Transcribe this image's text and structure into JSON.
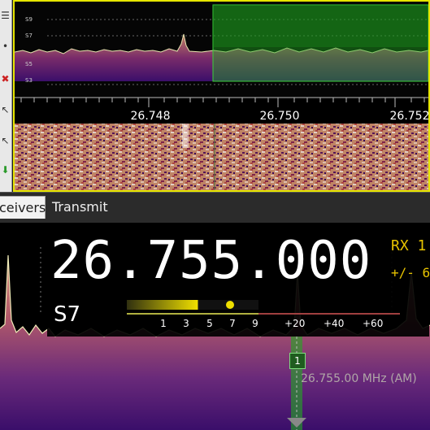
{
  "toolbar": {
    "buttons": [
      {
        "glyph": "☰",
        "icon": "menu-icon"
      },
      {
        "glyph": "•",
        "icon": "dot-icon"
      },
      {
        "glyph": "✖",
        "icon": "close-red-icon"
      },
      {
        "glyph": "↖",
        "icon": "pointer-icon"
      },
      {
        "glyph": "↖",
        "icon": "select-icon"
      },
      {
        "glyph": "⬇",
        "icon": "down-arrow-icon"
      }
    ]
  },
  "spectrum_top": {
    "db_labels": [
      "S9",
      "S7",
      "S5",
      "S3"
    ],
    "freq_labels": [
      "26.748",
      "26.750",
      "26.752"
    ],
    "passband_color": "#1a8f1a",
    "border_color": "#e6e600"
  },
  "tabs": [
    {
      "label": "ceivers",
      "active": true
    },
    {
      "label": "Transmit",
      "active": false
    }
  ],
  "receiver": {
    "frequency": "26.755.000",
    "rx_label": "RX 1",
    "tolerance": "+/- 6",
    "s_reading": "S7",
    "smeter_scale": [
      "1",
      "3",
      "5",
      "7",
      "9",
      "+20",
      "+40",
      "+60"
    ],
    "smeter_level": 0.54,
    "vfo_number": "1",
    "vfo_frequency": "26.755.00 MHz (AM)",
    "accent_color": "#e6c200"
  }
}
